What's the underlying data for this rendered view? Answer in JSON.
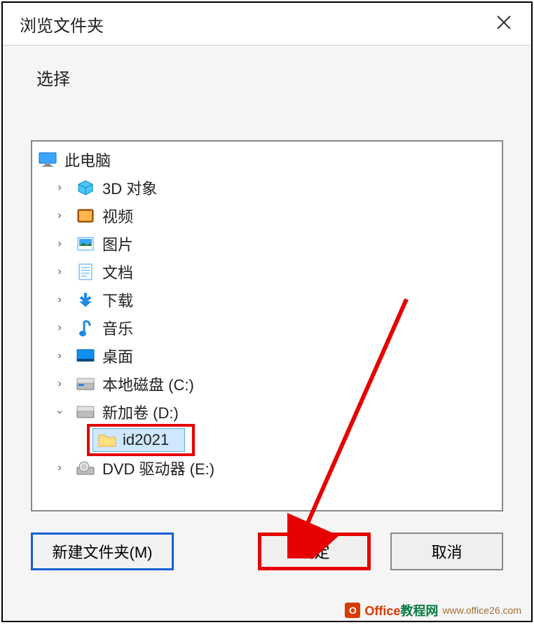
{
  "dialog": {
    "title": "浏览文件夹",
    "subtitle": "选择"
  },
  "tree": {
    "root": {
      "label": "此电脑"
    },
    "items": [
      {
        "label": "3D 对象"
      },
      {
        "label": "视频"
      },
      {
        "label": "图片"
      },
      {
        "label": "文档"
      },
      {
        "label": "下载"
      },
      {
        "label": "音乐"
      },
      {
        "label": "桌面"
      },
      {
        "label": "本地磁盘 (C:)"
      },
      {
        "label": "新加卷 (D:)",
        "expanded": true
      },
      {
        "label": "DVD 驱动器 (E:)"
      }
    ],
    "selected": {
      "label": "id2021"
    }
  },
  "buttons": {
    "new_folder": "新建文件夹(M)",
    "ok": "确定",
    "cancel": "取消"
  },
  "watermark": {
    "text1": "Office",
    "text2": "教程网",
    "url": "www.office26.com"
  }
}
